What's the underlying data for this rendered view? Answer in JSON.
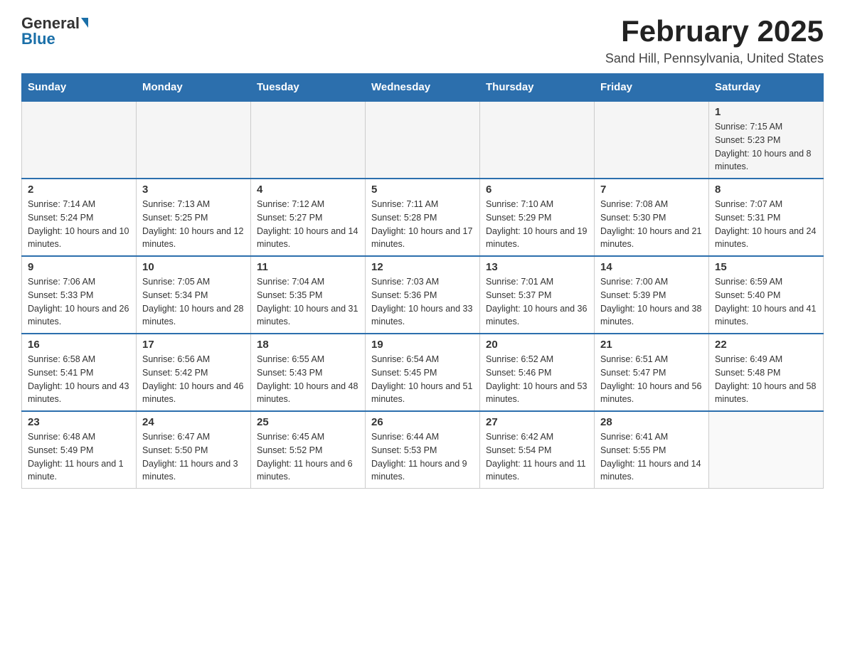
{
  "logo": {
    "general": "General",
    "blue": "Blue"
  },
  "title": "February 2025",
  "location": "Sand Hill, Pennsylvania, United States",
  "days_of_week": [
    "Sunday",
    "Monday",
    "Tuesday",
    "Wednesday",
    "Thursday",
    "Friday",
    "Saturday"
  ],
  "weeks": [
    [
      {
        "day": "",
        "info": ""
      },
      {
        "day": "",
        "info": ""
      },
      {
        "day": "",
        "info": ""
      },
      {
        "day": "",
        "info": ""
      },
      {
        "day": "",
        "info": ""
      },
      {
        "day": "",
        "info": ""
      },
      {
        "day": "1",
        "info": "Sunrise: 7:15 AM\nSunset: 5:23 PM\nDaylight: 10 hours and 8 minutes."
      }
    ],
    [
      {
        "day": "2",
        "info": "Sunrise: 7:14 AM\nSunset: 5:24 PM\nDaylight: 10 hours and 10 minutes."
      },
      {
        "day": "3",
        "info": "Sunrise: 7:13 AM\nSunset: 5:25 PM\nDaylight: 10 hours and 12 minutes."
      },
      {
        "day": "4",
        "info": "Sunrise: 7:12 AM\nSunset: 5:27 PM\nDaylight: 10 hours and 14 minutes."
      },
      {
        "day": "5",
        "info": "Sunrise: 7:11 AM\nSunset: 5:28 PM\nDaylight: 10 hours and 17 minutes."
      },
      {
        "day": "6",
        "info": "Sunrise: 7:10 AM\nSunset: 5:29 PM\nDaylight: 10 hours and 19 minutes."
      },
      {
        "day": "7",
        "info": "Sunrise: 7:08 AM\nSunset: 5:30 PM\nDaylight: 10 hours and 21 minutes."
      },
      {
        "day": "8",
        "info": "Sunrise: 7:07 AM\nSunset: 5:31 PM\nDaylight: 10 hours and 24 minutes."
      }
    ],
    [
      {
        "day": "9",
        "info": "Sunrise: 7:06 AM\nSunset: 5:33 PM\nDaylight: 10 hours and 26 minutes."
      },
      {
        "day": "10",
        "info": "Sunrise: 7:05 AM\nSunset: 5:34 PM\nDaylight: 10 hours and 28 minutes."
      },
      {
        "day": "11",
        "info": "Sunrise: 7:04 AM\nSunset: 5:35 PM\nDaylight: 10 hours and 31 minutes."
      },
      {
        "day": "12",
        "info": "Sunrise: 7:03 AM\nSunset: 5:36 PM\nDaylight: 10 hours and 33 minutes."
      },
      {
        "day": "13",
        "info": "Sunrise: 7:01 AM\nSunset: 5:37 PM\nDaylight: 10 hours and 36 minutes."
      },
      {
        "day": "14",
        "info": "Sunrise: 7:00 AM\nSunset: 5:39 PM\nDaylight: 10 hours and 38 minutes."
      },
      {
        "day": "15",
        "info": "Sunrise: 6:59 AM\nSunset: 5:40 PM\nDaylight: 10 hours and 41 minutes."
      }
    ],
    [
      {
        "day": "16",
        "info": "Sunrise: 6:58 AM\nSunset: 5:41 PM\nDaylight: 10 hours and 43 minutes."
      },
      {
        "day": "17",
        "info": "Sunrise: 6:56 AM\nSunset: 5:42 PM\nDaylight: 10 hours and 46 minutes."
      },
      {
        "day": "18",
        "info": "Sunrise: 6:55 AM\nSunset: 5:43 PM\nDaylight: 10 hours and 48 minutes."
      },
      {
        "day": "19",
        "info": "Sunrise: 6:54 AM\nSunset: 5:45 PM\nDaylight: 10 hours and 51 minutes."
      },
      {
        "day": "20",
        "info": "Sunrise: 6:52 AM\nSunset: 5:46 PM\nDaylight: 10 hours and 53 minutes."
      },
      {
        "day": "21",
        "info": "Sunrise: 6:51 AM\nSunset: 5:47 PM\nDaylight: 10 hours and 56 minutes."
      },
      {
        "day": "22",
        "info": "Sunrise: 6:49 AM\nSunset: 5:48 PM\nDaylight: 10 hours and 58 minutes."
      }
    ],
    [
      {
        "day": "23",
        "info": "Sunrise: 6:48 AM\nSunset: 5:49 PM\nDaylight: 11 hours and 1 minute."
      },
      {
        "day": "24",
        "info": "Sunrise: 6:47 AM\nSunset: 5:50 PM\nDaylight: 11 hours and 3 minutes."
      },
      {
        "day": "25",
        "info": "Sunrise: 6:45 AM\nSunset: 5:52 PM\nDaylight: 11 hours and 6 minutes."
      },
      {
        "day": "26",
        "info": "Sunrise: 6:44 AM\nSunset: 5:53 PM\nDaylight: 11 hours and 9 minutes."
      },
      {
        "day": "27",
        "info": "Sunrise: 6:42 AM\nSunset: 5:54 PM\nDaylight: 11 hours and 11 minutes."
      },
      {
        "day": "28",
        "info": "Sunrise: 6:41 AM\nSunset: 5:55 PM\nDaylight: 11 hours and 14 minutes."
      },
      {
        "day": "",
        "info": ""
      }
    ]
  ]
}
